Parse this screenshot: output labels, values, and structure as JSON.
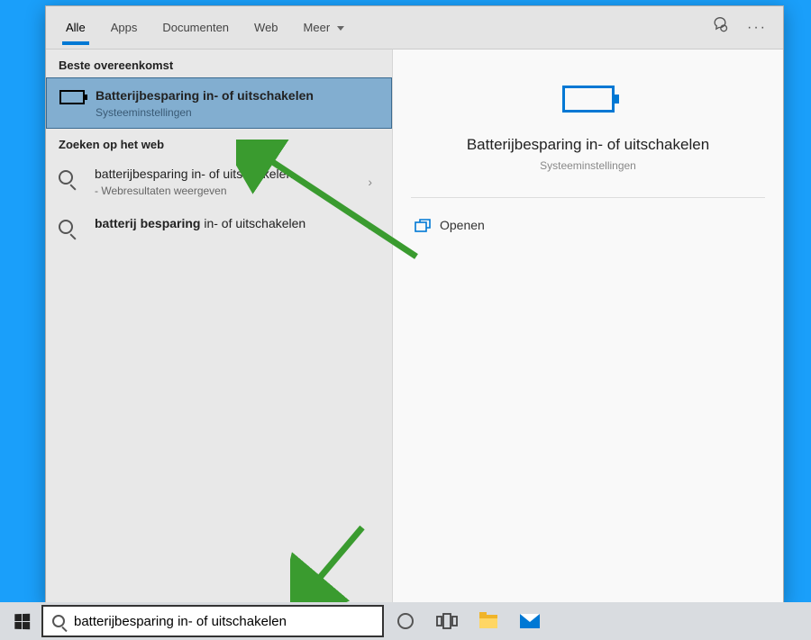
{
  "tabs": {
    "all": "Alle",
    "apps": "Apps",
    "documents": "Documenten",
    "web": "Web",
    "more": "Meer"
  },
  "sections": {
    "best_match": "Beste overeenkomst",
    "web_search": "Zoeken op het web"
  },
  "best_match": {
    "title": "Batterijbesparing in- of uitschakelen",
    "sub": "Systeeminstellingen"
  },
  "web_results": [
    {
      "title": "batterijbesparing in- of uitschakelen",
      "sub": "- Webresultaten weergeven"
    },
    {
      "title_bold": "batterij besparing",
      "title_rest": " in- of uitschakelen"
    }
  ],
  "preview": {
    "title": "Batterijbesparing in- of uitschakelen",
    "sub": "Systeeminstellingen",
    "open": "Openen"
  },
  "search": {
    "value": "batterijbesparing in- of uitschakelen"
  }
}
